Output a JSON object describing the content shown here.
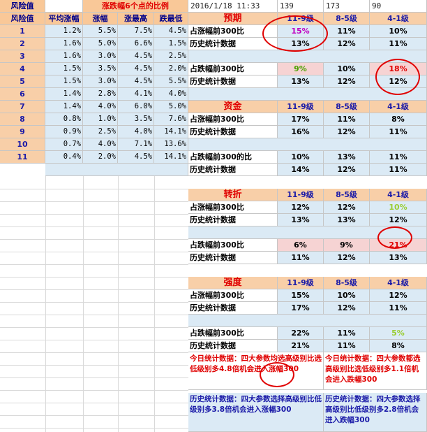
{
  "header": {
    "title": "涨跌幅6个点的比例",
    "datetime": "2016/1/18 11:33",
    "num1": "139",
    "num2": "173",
    "num3": "90"
  },
  "columns": [
    "风险值",
    "平均涨幅",
    "涨幅",
    "涨最高",
    "跌最低"
  ],
  "risk_rows": [
    [
      "1",
      "1.2%",
      "5.5%",
      "7.5%",
      "4.5%"
    ],
    [
      "2",
      "1.6%",
      "5.0%",
      "6.6%",
      "1.5%"
    ],
    [
      "3",
      "1.6%",
      "3.0%",
      "4.5%",
      "2.5%"
    ],
    [
      "4",
      "1.5%",
      "3.5%",
      "4.5%",
      "2.0%"
    ],
    [
      "5",
      "1.5%",
      "3.0%",
      "4.5%",
      "5.5%"
    ],
    [
      "6",
      "1.4%",
      "2.8%",
      "4.1%",
      "4.0%"
    ],
    [
      "7",
      "1.4%",
      "4.0%",
      "6.0%",
      "5.0%"
    ],
    [
      "8",
      "0.8%",
      "1.0%",
      "3.5%",
      "7.6%"
    ],
    [
      "9",
      "0.9%",
      "2.5%",
      "4.0%",
      "14.1%"
    ],
    [
      "10",
      "0.7%",
      "4.0%",
      "7.1%",
      "13.6%"
    ],
    [
      "11",
      "0.4%",
      "2.0%",
      "4.5%",
      "14.1%"
    ]
  ],
  "grade_headers": [
    "11-9级",
    "8-5级",
    "4-1级"
  ],
  "sections": {
    "yuqi": {
      "name": "预期",
      "rows": [
        {
          "label": "占涨幅前300比",
          "v": [
            "15%",
            "11%",
            "10%"
          ]
        },
        {
          "label": "历史统计数据",
          "v": [
            "13%",
            "12%",
            "11%"
          ]
        },
        {
          "label": "占跌幅前300比",
          "v": [
            "9%",
            "10%",
            "18%"
          ]
        },
        {
          "label": "历史统计数据",
          "v": [
            "13%",
            "12%",
            "12%"
          ]
        }
      ]
    },
    "zijin": {
      "name": "资金",
      "rows": [
        {
          "label": "占涨幅前300比",
          "v": [
            "17%",
            "11%",
            "8%"
          ]
        },
        {
          "label": "历史统计数据",
          "v": [
            "16%",
            "12%",
            "11%"
          ]
        },
        {
          "label": "占跌幅前300的比",
          "v": [
            "10%",
            "13%",
            "11%"
          ]
        },
        {
          "label": "历史统计数据",
          "v": [
            "14%",
            "12%",
            "11%"
          ]
        }
      ]
    },
    "zhuanzhe": {
      "name": "转折",
      "rows": [
        {
          "label": "占涨幅前300比",
          "v": [
            "12%",
            "12%",
            "10%"
          ]
        },
        {
          "label": "历史统计数据",
          "v": [
            "13%",
            "13%",
            "12%"
          ]
        },
        {
          "label": "占跌幅前300比",
          "v": [
            "6%",
            "9%",
            "21%"
          ]
        },
        {
          "label": "历史统计数据",
          "v": [
            "11%",
            "12%",
            "13%"
          ]
        }
      ]
    },
    "qiangdu": {
      "name": "强度",
      "rows": [
        {
          "label": "占涨幅前300比",
          "v": [
            "15%",
            "10%",
            "12%"
          ]
        },
        {
          "label": "历史统计数据",
          "v": [
            "17%",
            "12%",
            "11%"
          ]
        },
        {
          "label": "占跌幅前300比",
          "v": [
            "22%",
            "11%",
            "5%"
          ]
        },
        {
          "label": "历史统计数据",
          "v": [
            "21%",
            "11%",
            "8%"
          ]
        }
      ]
    }
  },
  "notes": {
    "today_up": "今日统计数据：四大参数均选高级别比选低级别多4.8倍机会进入涨幅300",
    "today_down": "今日统计数据：四大参数都选高级别比选低级别多1.1倍机会进入跌幅300",
    "hist_up": "历史统计数据：四大参数选择高级别比低级别多3.8倍机会进入涨幅300",
    "hist_down": "历史统计数据：四大参数选择高级别比低级别多2.8倍机会进入跌幅300"
  },
  "colors": {
    "header_bg": "#f9c898",
    "data_bg": "#dbeaf5",
    "section_title": "#e00000",
    "grade_text": "#1a1aa8",
    "highlight_circle": "#e00000"
  }
}
